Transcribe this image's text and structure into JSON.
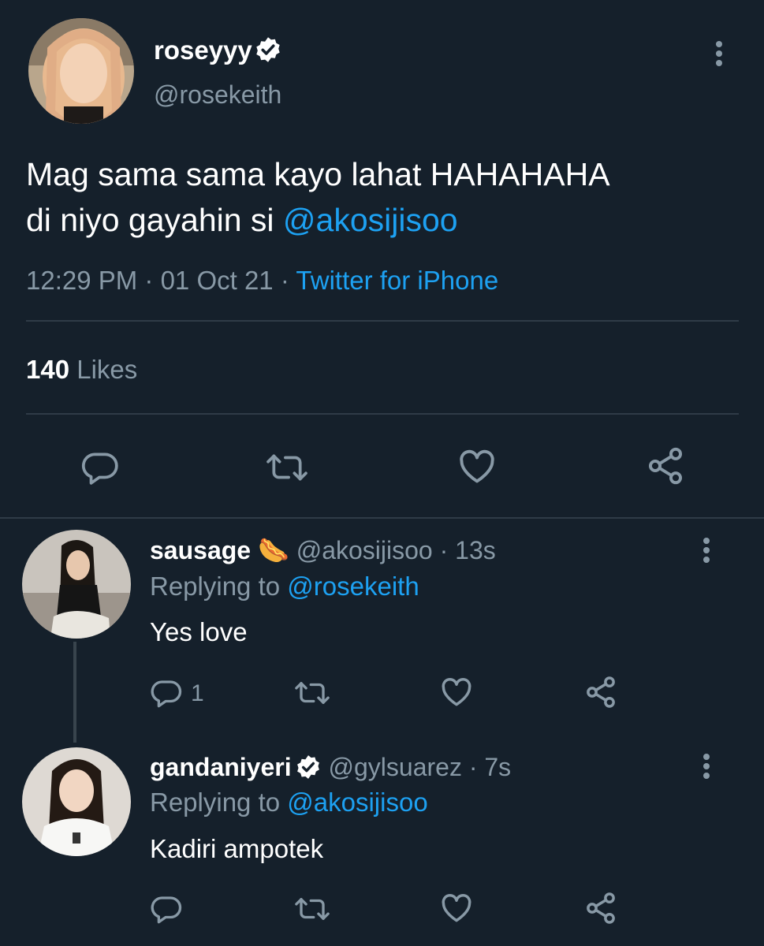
{
  "main_tweet": {
    "display_name": "roseyyy",
    "handle": "@rosekeith",
    "text_line1": "Mag sama sama kayo lahat HAHAHAHA",
    "text_line2_prefix": "di niyo gayahin si ",
    "text_mention": "@akosijisoo",
    "time": "12:29 PM",
    "date": "01 Oct 21",
    "source": "Twitter for iPhone",
    "likes_count": "140",
    "likes_label": "Likes"
  },
  "replies": [
    {
      "display_name": "sausage",
      "emoji": "🌭",
      "handle": "@akosijisoo",
      "age": "13s",
      "replying_label": "Replying to ",
      "replying_to": "@rosekeith",
      "text": "Yes love",
      "reply_count": "1"
    },
    {
      "display_name": "gandaniyeri",
      "handle": "@gylsuarez",
      "age": "7s",
      "replying_label": "Replying to ",
      "replying_to": "@akosijisoo",
      "text": "Kadiri ampotek",
      "reply_count": ""
    }
  ],
  "separator": " · ",
  "colors": {
    "background": "#15202b",
    "text": "#ffffff",
    "muted": "#8899a6",
    "accent": "#1da1f2",
    "divider": "#2f3b47"
  },
  "icons": [
    "reply-icon",
    "retweet-icon",
    "like-icon",
    "share-icon",
    "more-icon",
    "verified-icon"
  ]
}
